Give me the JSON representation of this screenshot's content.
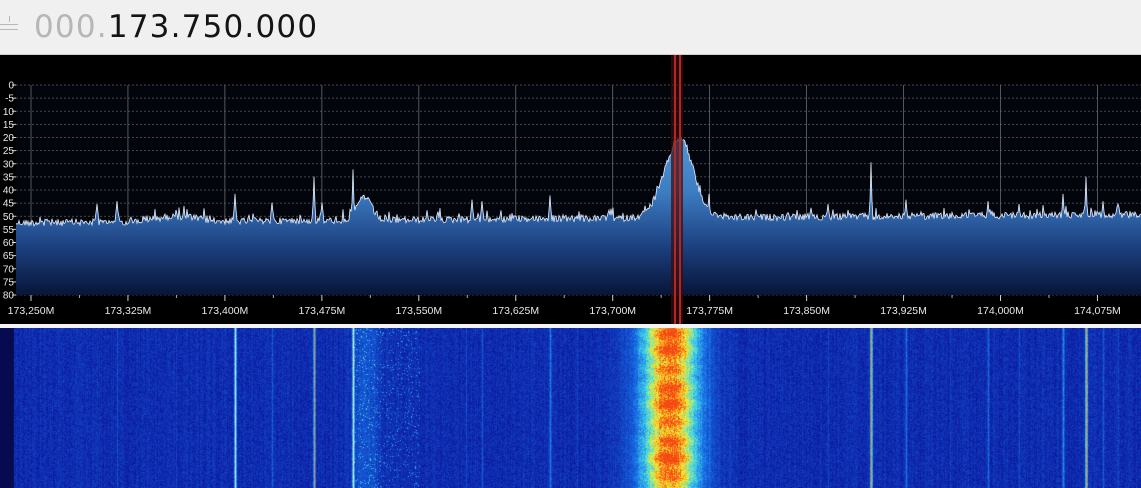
{
  "frequency": {
    "leading_digits": "000.",
    "value_digits": "173.750.000"
  },
  "spectrum": {
    "db_ticks": [
      "0",
      "-5",
      "10",
      "15",
      "20",
      "25",
      "30",
      "35",
      "40",
      "45",
      "50",
      "55",
      "60",
      "65",
      "70",
      "75",
      "80"
    ],
    "frequency_labels": [
      "173,250M",
      "173,325M",
      "173,400M",
      "173,475M",
      "173,550M",
      "173,625M",
      "173,700M",
      "173,775M",
      "173,850M",
      "173,925M",
      "174,000M",
      "174,075M"
    ]
  },
  "colors": {
    "grid": "#6a6a6a",
    "trace": "#e8f0ff",
    "fill_top": "#3f82c8",
    "fill_bottom": "#08173c",
    "marker": "#c03030",
    "waterfall_bg": "#0c1a9a",
    "waterfall_hot": "#ffee20"
  },
  "icons": {
    "tuner_handle": "tuner-handle-icon"
  }
}
